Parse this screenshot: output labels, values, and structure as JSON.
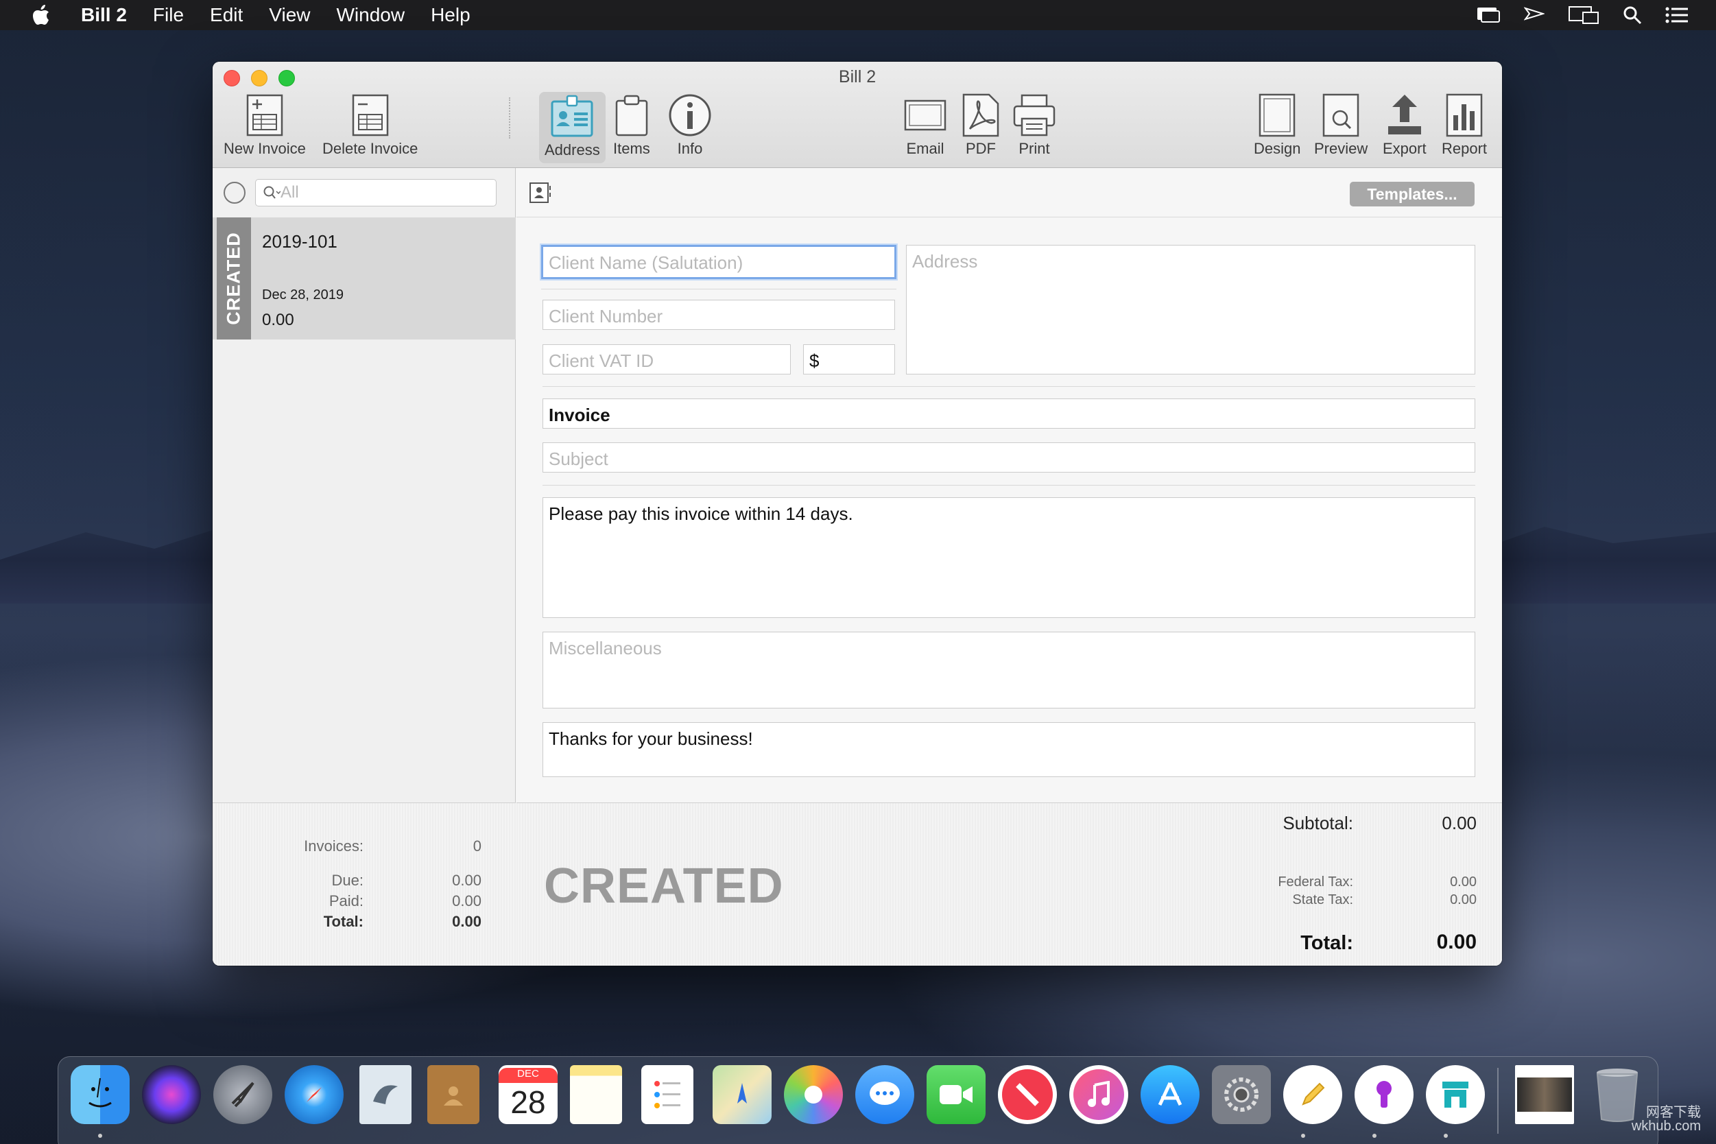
{
  "menubar": {
    "app_name": "Bill 2",
    "items": [
      "File",
      "Edit",
      "View",
      "Window",
      "Help"
    ],
    "icons": [
      "screens-icon",
      "send-icon",
      "display-icon",
      "spotlight-search-icon",
      "notification-list-icon"
    ]
  },
  "window": {
    "title": "Bill 2",
    "toolbar": {
      "new_invoice": "New Invoice",
      "delete_invoice": "Delete Invoice",
      "address": "Address",
      "items": "Items",
      "info": "Info",
      "email": "Email",
      "pdf": "PDF",
      "print": "Print",
      "design": "Design",
      "preview": "Preview",
      "export": "Export",
      "report": "Report"
    }
  },
  "sidebar": {
    "search_placeholder": "All",
    "invoice": {
      "status": "CREATED",
      "number": "2019-101",
      "date": "Dec 28, 2019",
      "amount": "0.00"
    },
    "summary": {
      "invoices_label": "Invoices:",
      "invoices_value": "0",
      "due_label": "Due:",
      "due_value": "0.00",
      "paid_label": "Paid:",
      "paid_value": "0.00",
      "total_label": "Total:",
      "total_value": "0.00"
    }
  },
  "main": {
    "templates_button": "Templates...",
    "fields": {
      "client_name_placeholder": "Client Name (Salutation)",
      "client_number_placeholder": "Client Number",
      "client_vat_placeholder": "Client VAT ID",
      "currency": "$",
      "address_placeholder": "Address",
      "title": "Invoice",
      "subject_placeholder": "Subject",
      "intro_text": "Please pay this invoice within 14 days.",
      "misc_placeholder": "Miscellaneous",
      "closing_text": "Thanks for your business!"
    },
    "footer": {
      "status": "CREATED",
      "subtotal_label": "Subtotal:",
      "subtotal_value": "0.00",
      "federal_tax_label": "Federal Tax:",
      "federal_tax_value": "0.00",
      "state_tax_label": "State Tax:",
      "state_tax_value": "0.00",
      "total_label": "Total:",
      "total_value": "0.00"
    }
  },
  "dock": {
    "apps": [
      "finder",
      "siri",
      "launchpad",
      "safari",
      "mail",
      "contacts",
      "calendar",
      "notes",
      "reminders",
      "maps",
      "photos",
      "messages",
      "facetime",
      "news",
      "music",
      "app-store",
      "system-preferences",
      "pencil-app",
      "keychain-app",
      "store-app",
      "movie-file",
      "trash"
    ],
    "calendar_month": "DEC",
    "calendar_day": "28"
  },
  "watermark": {
    "line1": "网客下载",
    "line2": "wkhub.com"
  }
}
